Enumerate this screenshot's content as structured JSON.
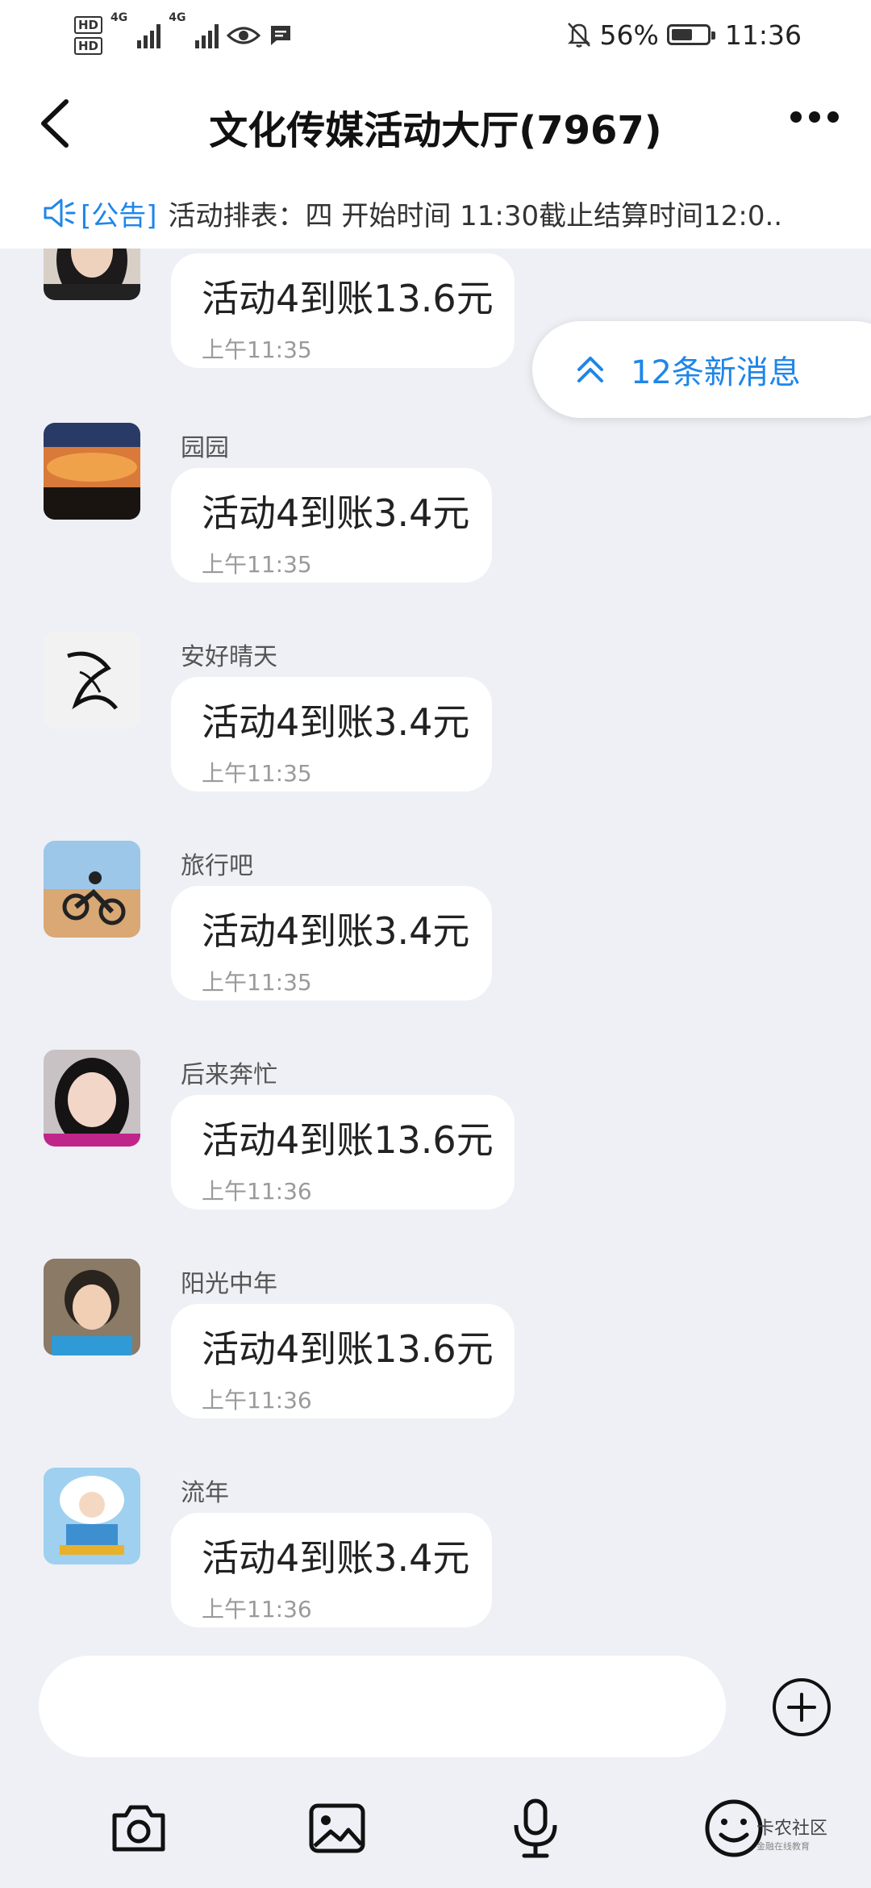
{
  "status_bar": {
    "hd1": "HD",
    "hd2": "HD",
    "net1": "4G",
    "net2": "4G",
    "battery_text": "56%",
    "time": "11:36",
    "battery_level": 0.56
  },
  "header": {
    "title": "文化传媒活动大厅(7967)"
  },
  "notice": {
    "tag": "[公告]",
    "text": "活动排表：四 开始时间 11:30截止结算时间12:0.."
  },
  "new_messages": {
    "label": "12条新消息"
  },
  "messages": [
    {
      "sender": "",
      "text": "活动4到账13.6元",
      "time": "上午11:35",
      "avatar": "woman-photo"
    },
    {
      "sender": "园园",
      "text": "活动4到账3.4元",
      "time": "上午11:35",
      "avatar": "sunset-clouds"
    },
    {
      "sender": "安好晴天",
      "text": "活动4到账3.4元",
      "time": "上午11:35",
      "avatar": "ink-sketch"
    },
    {
      "sender": "旅行吧",
      "text": "活动4到账3.4元",
      "time": "上午11:35",
      "avatar": "desert-motorbike"
    },
    {
      "sender": "后来奔忙",
      "text": "活动4到账13.6元",
      "time": "上午11:36",
      "avatar": "woman-portrait"
    },
    {
      "sender": "阳光中年",
      "text": "活动4到账13.6元",
      "time": "上午11:36",
      "avatar": "young-man"
    },
    {
      "sender": "流年",
      "text": "活动4到账3.4元",
      "time": "上午11:36",
      "avatar": "meditation-figure"
    }
  ],
  "input": {
    "placeholder": ""
  },
  "toolbar": {
    "icons": [
      "camera-icon",
      "image-icon",
      "microphone-icon",
      "emoji-icon"
    ]
  },
  "watermark": {
    "title": "卡农社区",
    "subtitle": "金融在线教育"
  },
  "colors": {
    "accent": "#1f86e8",
    "background": "#eef0f5",
    "bubble": "#ffffff"
  }
}
